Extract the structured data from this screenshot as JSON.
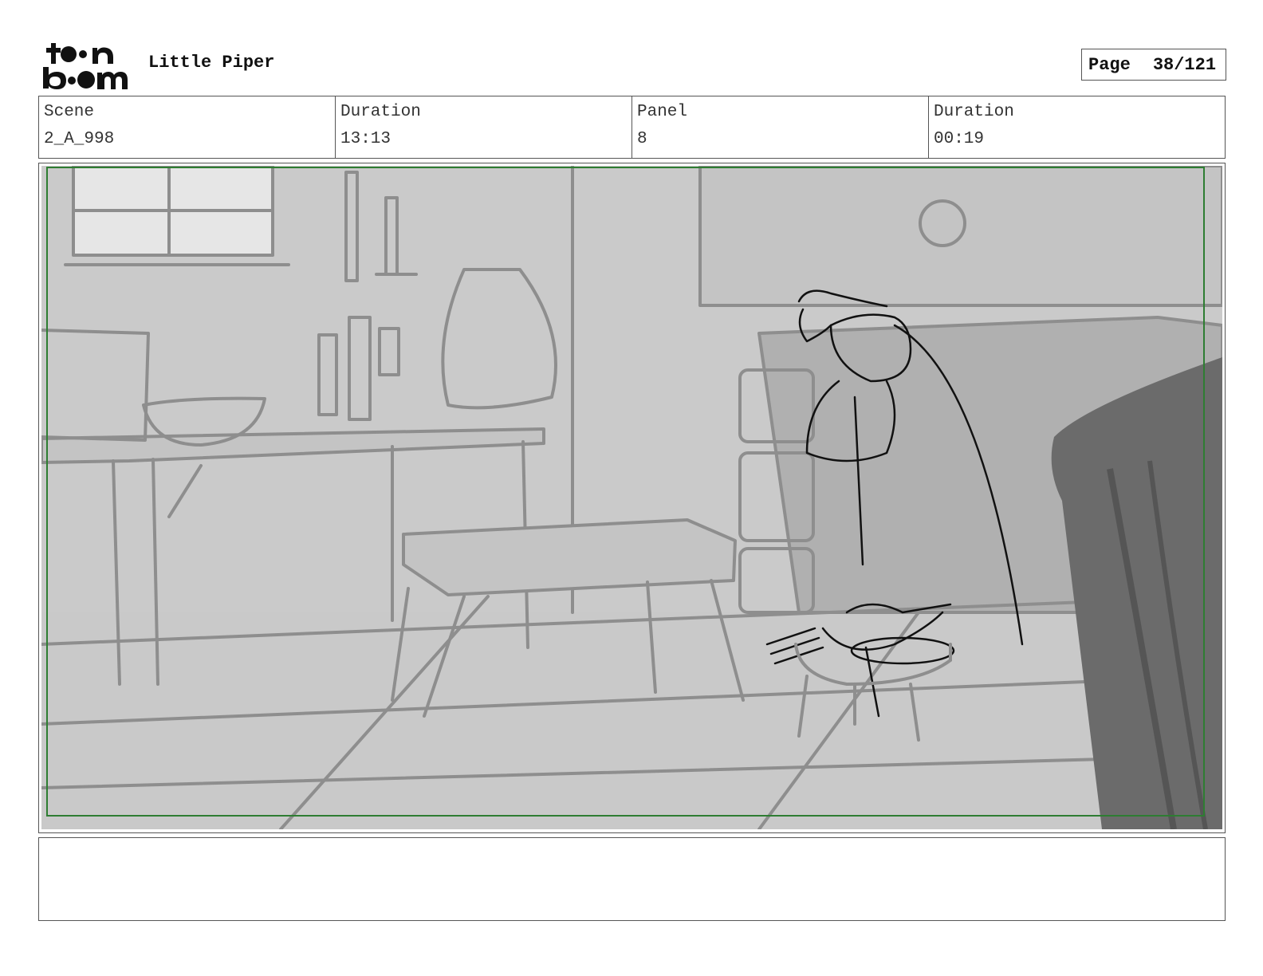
{
  "header": {
    "logo_text": "toon boom",
    "project_title": "Little Piper",
    "page_label": "Page",
    "page_value": "38/121"
  },
  "info": [
    {
      "heading": "Scene",
      "value": "2_A_998"
    },
    {
      "heading": "Duration",
      "value": "13:13"
    },
    {
      "heading": "Panel",
      "value": "8"
    },
    {
      "heading": "Duration",
      "value": "00:19"
    }
  ],
  "panel": {
    "safe_frame_color": "#2e7d32",
    "background_color": "#c8c8c8"
  },
  "caption": {
    "text": ""
  }
}
